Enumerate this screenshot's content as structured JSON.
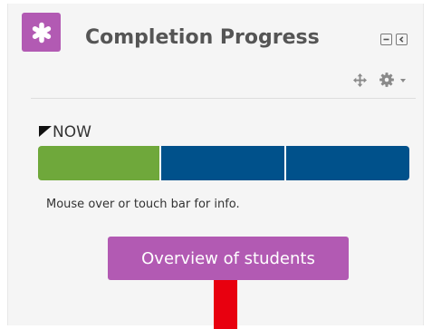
{
  "block": {
    "title": "Completion Progress",
    "icon": "asterisk-icon",
    "controls": [
      "collapse-icon",
      "dock-icon"
    ],
    "actions": [
      "move-icon",
      "gear-icon",
      "caret-down-icon"
    ]
  },
  "progress": {
    "now_label": "NOW",
    "segments": [
      {
        "name": "segment-1",
        "color": "#6fa83b"
      },
      {
        "name": "segment-2",
        "color": "#00518b"
      },
      {
        "name": "segment-3",
        "color": "#00518b"
      }
    ],
    "help_text": "Mouse over or touch bar for info."
  },
  "buttons": {
    "overview_label": "Overview of students"
  },
  "colors": {
    "accent": "#b25ab3",
    "complete": "#6fa83b",
    "incomplete": "#00518b",
    "annotation": "#e8000f"
  }
}
